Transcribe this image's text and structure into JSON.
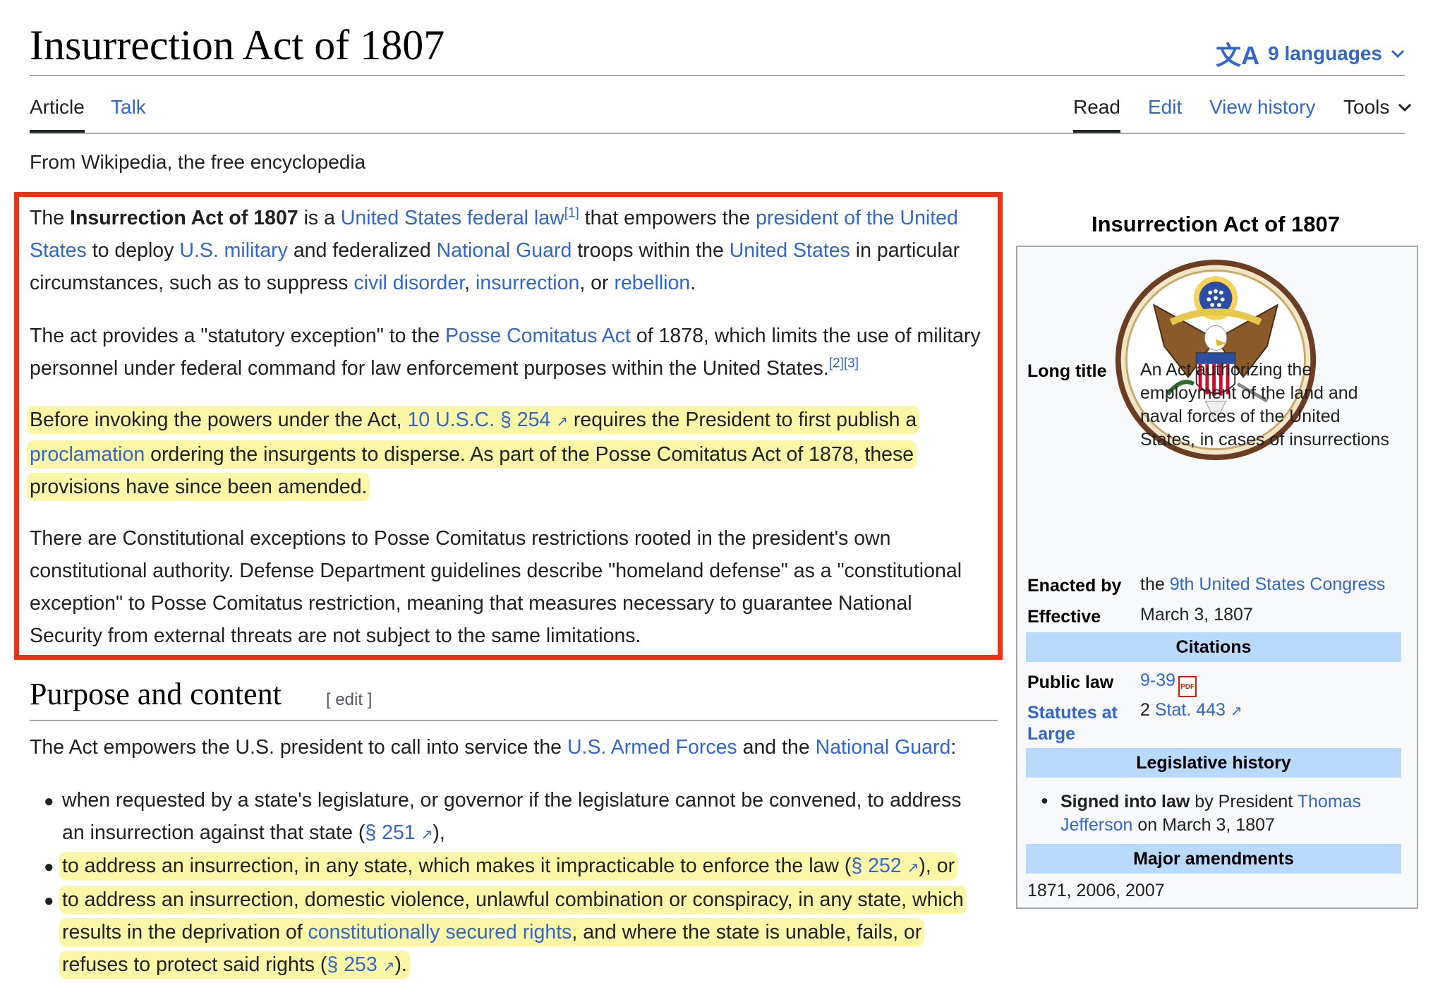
{
  "header": {
    "title": "Insurrection Act of 1807",
    "languages_label": "9 languages",
    "languages_icon": "translate-icon"
  },
  "tabs": {
    "article": "Article",
    "talk": "Talk",
    "read": "Read",
    "edit": "Edit",
    "view_history": "View history",
    "tools": "Tools"
  },
  "tagline": "From Wikipedia, the free encyclopedia",
  "intro": {
    "p1": {
      "t1": "The ",
      "bold": "Insurrection Act of 1807",
      "t2": " is a ",
      "l1": "United States federal law",
      "ref1": "[1]",
      "t3": " that empowers the ",
      "l2a": "president of the United",
      "l2b": "States",
      "t4": " to deploy ",
      "l3": "U.S. military",
      "t5": " and federalized ",
      "l4": "National Guard",
      "t6": " troops within the ",
      "l5": "United States",
      "t7": " in particular",
      "t8": "circumstances, such as to suppress ",
      "l6": "civil disorder",
      "t9": ", ",
      "l7": "insurrection",
      "t10": ", or ",
      "l8": "rebellion",
      "t11": "."
    },
    "p2": {
      "t1": "The act provides a \"statutory exception\" to the ",
      "l1": "Posse Comitatus Act",
      "t2": " of 1878, which limits the use of military",
      "t3": "personnel under federal command for law enforcement purposes within the United States.",
      "ref": "[2][3]"
    },
    "p3": {
      "t1": "Before invoking the powers under the Act, ",
      "l1": "10 U.S.C. § 254",
      "t2": " requires the President to first publish a",
      "l2": "proclamation",
      "t3": " ordering the insurgents to disperse. As part of the Posse Comitatus Act of 1878, these",
      "t4": "provisions have since been amended."
    },
    "p4": {
      "line1": "There are Constitutional exceptions to Posse Comitatus restrictions rooted in the president's own",
      "line2": "constitutional authority. Defense Department guidelines describe \"homeland defense\" as a \"constitutional",
      "line3": "exception\" to Posse Comitatus restriction, meaning that measures necessary to guarantee National",
      "line4": "Security from external threats are not subject to the same limitations."
    }
  },
  "section": {
    "heading": "Purpose and content",
    "edit_label": "[ edit ]",
    "lead": {
      "t1": "The Act empowers the U.S. president to call into service the ",
      "l1": "U.S. Armed Forces",
      "t2": " and the ",
      "l2": "National Guard",
      "t3": ":"
    },
    "items": [
      {
        "line1": "when requested by a state's legislature, or governor if the legislature cannot be convened, to address",
        "t2": "an insurrection against that state (",
        "link": "§ 251",
        "t3": "),"
      },
      {
        "t1": "to address an insurrection, in any state, which makes it impracticable to enforce the law (",
        "link": "§ 252",
        "t2": "), or"
      },
      {
        "line1": "to address an insurrection, domestic violence, unlawful combination or conspiracy, in any state, which",
        "t2": "results in the deprivation of ",
        "link1": "constitutionally secured rights",
        "t3": ", and where the state is unable, fails, or",
        "t4": "refuses to protect said rights (",
        "link2": "§ 253",
        "t5": ")."
      }
    ]
  },
  "infobox": {
    "caption": "Insurrection Act of 1807",
    "image": "great-seal-of-the-united-states",
    "long_title_label": "Long title",
    "long_title_value": [
      "An Act authorizing the",
      "employment of the land and",
      "naval forces of the United",
      "States, in cases of insurrections"
    ],
    "enacted_label": "Enacted by",
    "enacted_t": "the ",
    "enacted_link": "9th United States Congress",
    "effective_label": "Effective",
    "effective_value": "March 3, 1807",
    "citations_header": "Citations",
    "public_law_label": "Public law",
    "public_law_value": "9-39",
    "pdf_label": "PDF",
    "statutes_label_1": "Statutes at",
    "statutes_label_2": "Large",
    "statutes_t": "2 ",
    "statutes_link": "Stat. 443",
    "leg_history_header": "Legislative history",
    "signed_bold": "Signed into law",
    "signed_t1": " by President ",
    "signed_link1": "Thomas",
    "signed_link2": "Jefferson",
    "signed_t2": " on March 3, 1807",
    "amendments_header": "Major amendments",
    "amendments_value": "1871, 2006, 2007"
  },
  "colors": {
    "link": "#3366cc",
    "highlight": "#fbf7a6",
    "box_border": "#e8351a",
    "infobox_header": "#b9d9ff"
  }
}
